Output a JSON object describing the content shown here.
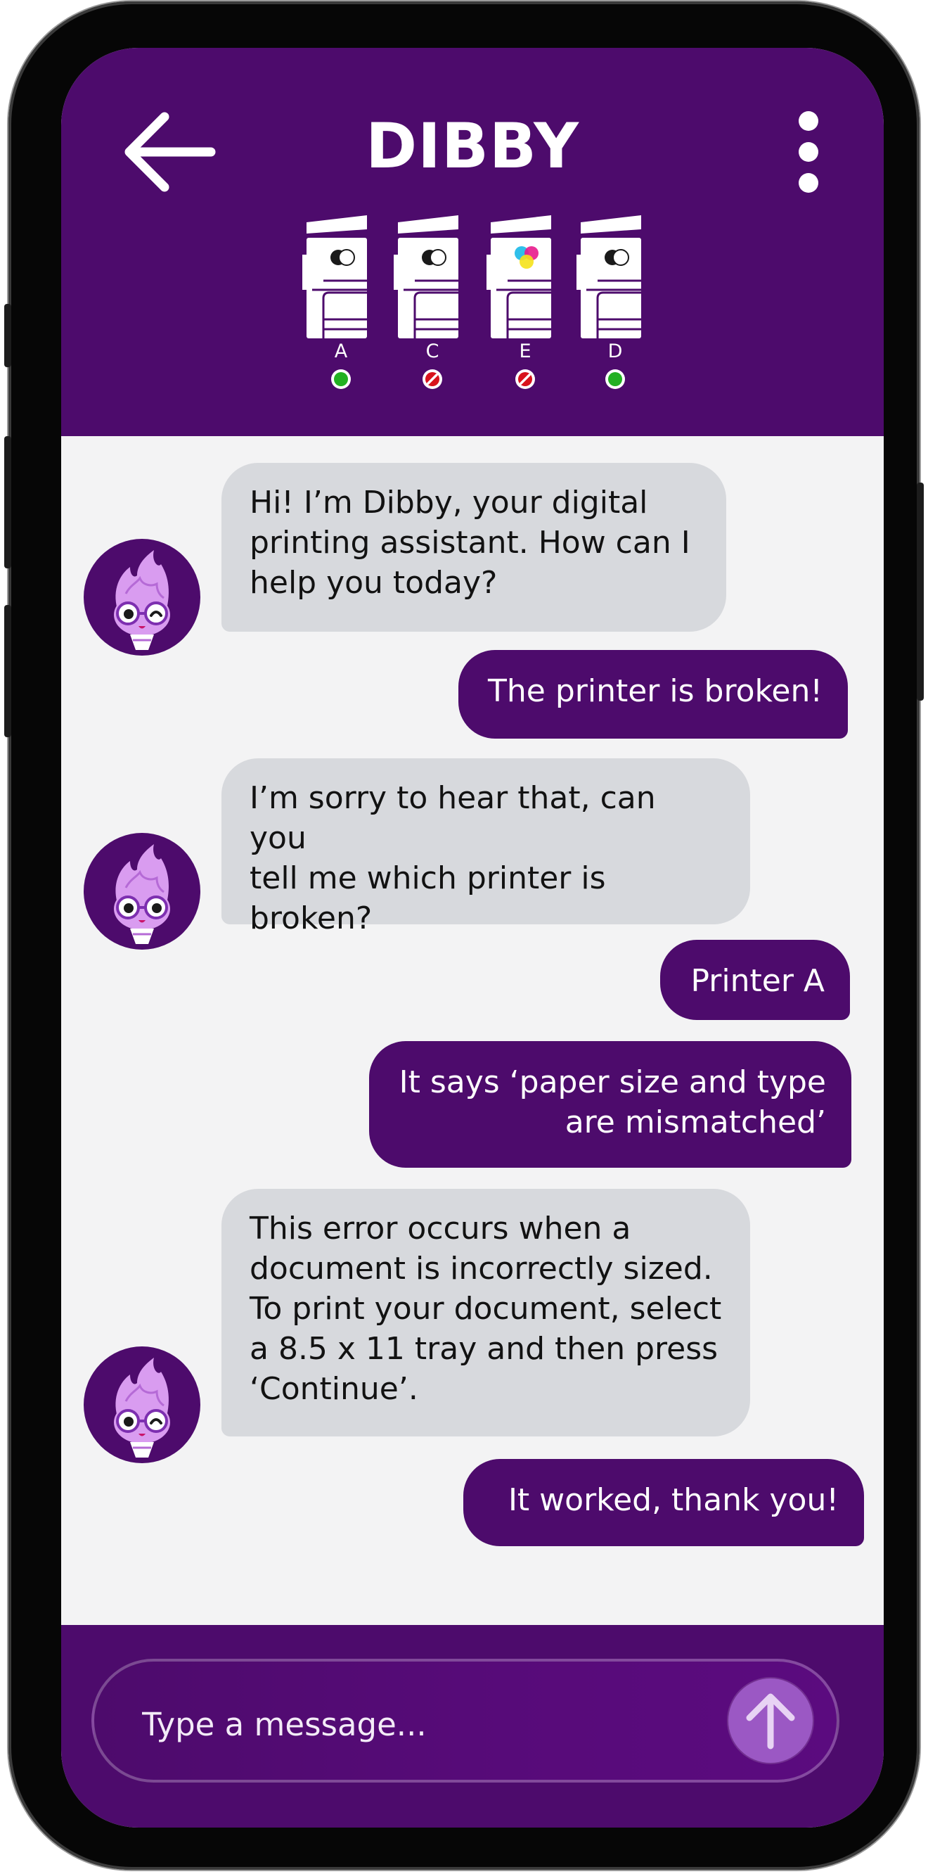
{
  "app": {
    "title": "DIBBY"
  },
  "colors": {
    "primary": "#4d0b6c",
    "bot_bubble": "#d7d9dd",
    "background": "#f3f3f4",
    "ok": "#22b022",
    "error": "#d8131c",
    "send": "#9b58c4"
  },
  "icons": {
    "back": "arrow-left-icon",
    "menu": "more-vertical-icon",
    "send": "arrow-up-icon",
    "avatar": "dibby-mascot-icon"
  },
  "printers": [
    {
      "label": "A",
      "status": "ok",
      "ink": "mono"
    },
    {
      "label": "C",
      "status": "error",
      "ink": "mono"
    },
    {
      "label": "E",
      "status": "error",
      "ink": "color"
    },
    {
      "label": "D",
      "status": "ok",
      "ink": "mono"
    }
  ],
  "messages": [
    {
      "sender": "bot",
      "lines": [
        "Hi! I’m Dibby, your digital",
        "printing assistant. How can I",
        "help you today?"
      ]
    },
    {
      "sender": "user",
      "lines": [
        "The printer is broken!"
      ]
    },
    {
      "sender": "bot",
      "lines": [
        "I’m sorry to hear that, can you",
        "tell me which printer is",
        "broken?"
      ]
    },
    {
      "sender": "user",
      "lines": [
        "Printer A"
      ]
    },
    {
      "sender": "user",
      "lines": [
        "It says ‘paper size and type",
        "are mismatched’"
      ]
    },
    {
      "sender": "bot",
      "lines": [
        "This error occurs when a",
        "document is incorrectly sized.",
        "To print your document, select",
        "a 8.5 x 11 tray and then press",
        "‘Continue’."
      ]
    },
    {
      "sender": "user",
      "lines": [
        "It worked, thank you!"
      ]
    }
  ],
  "composer": {
    "placeholder": "Type a message..."
  }
}
